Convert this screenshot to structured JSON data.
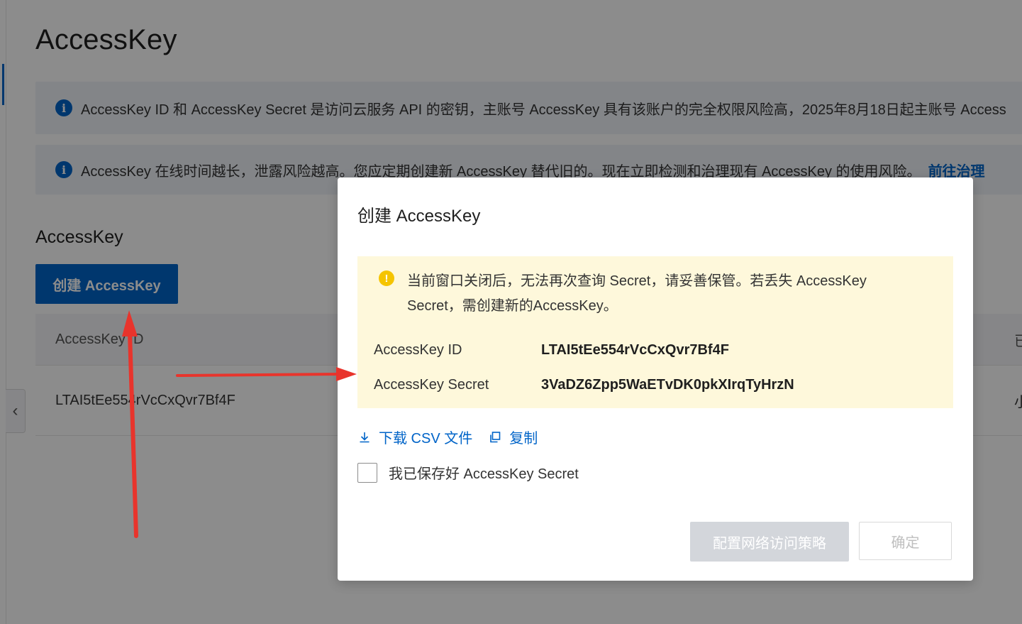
{
  "page": {
    "title": "AccessKey",
    "notice1": {
      "text": "AccessKey ID 和 AccessKey Secret 是访问云服务 API 的密钥，主账号 AccessKey 具有该账户的完全权限风险高，2025年8月18日起主账号 Access"
    },
    "notice2": {
      "text": "AccessKey 在线时间越长，泄露风险越高。您应定期创建新 AccessKey 替代旧的。现在立即检测和治理现有 AccessKey 的使用风险。",
      "link": "前往治理"
    },
    "section_title": "AccessKey",
    "create_button": "创建 AccessKey",
    "table": {
      "header_col1": "AccessKey ID",
      "header_right": "已",
      "row_id": "LTAI5tEe554rVcCxQvr7Bf4F",
      "row_right": "小"
    },
    "collapse_icon": "chevron-left-icon"
  },
  "modal": {
    "title": "创建 AccessKey",
    "warning_line1": "当前窗口关闭后，无法再次查询 Secret，请妥善保管。若丢失 AccessKey",
    "warning_line2": "Secret，需创建新的AccessKey。",
    "id_label": "AccessKey ID",
    "id_value": "LTAI5tEe554rVcCxQvr7Bf4F",
    "secret_label": "AccessKey Secret",
    "secret_value": "3VaDZ6Zpp5WaETvDK0pkXIrqTyHrzN",
    "download_label": "下载 CSV 文件",
    "copy_label": "复制",
    "checkbox_label": "我已保存好 AccessKey Secret",
    "policy_button": "配置网络访问策略",
    "ok_button": "确定"
  },
  "colors": {
    "primary": "#0064c8",
    "warning_bg": "#fef8db",
    "annotation_arrow": "#e8342c"
  }
}
